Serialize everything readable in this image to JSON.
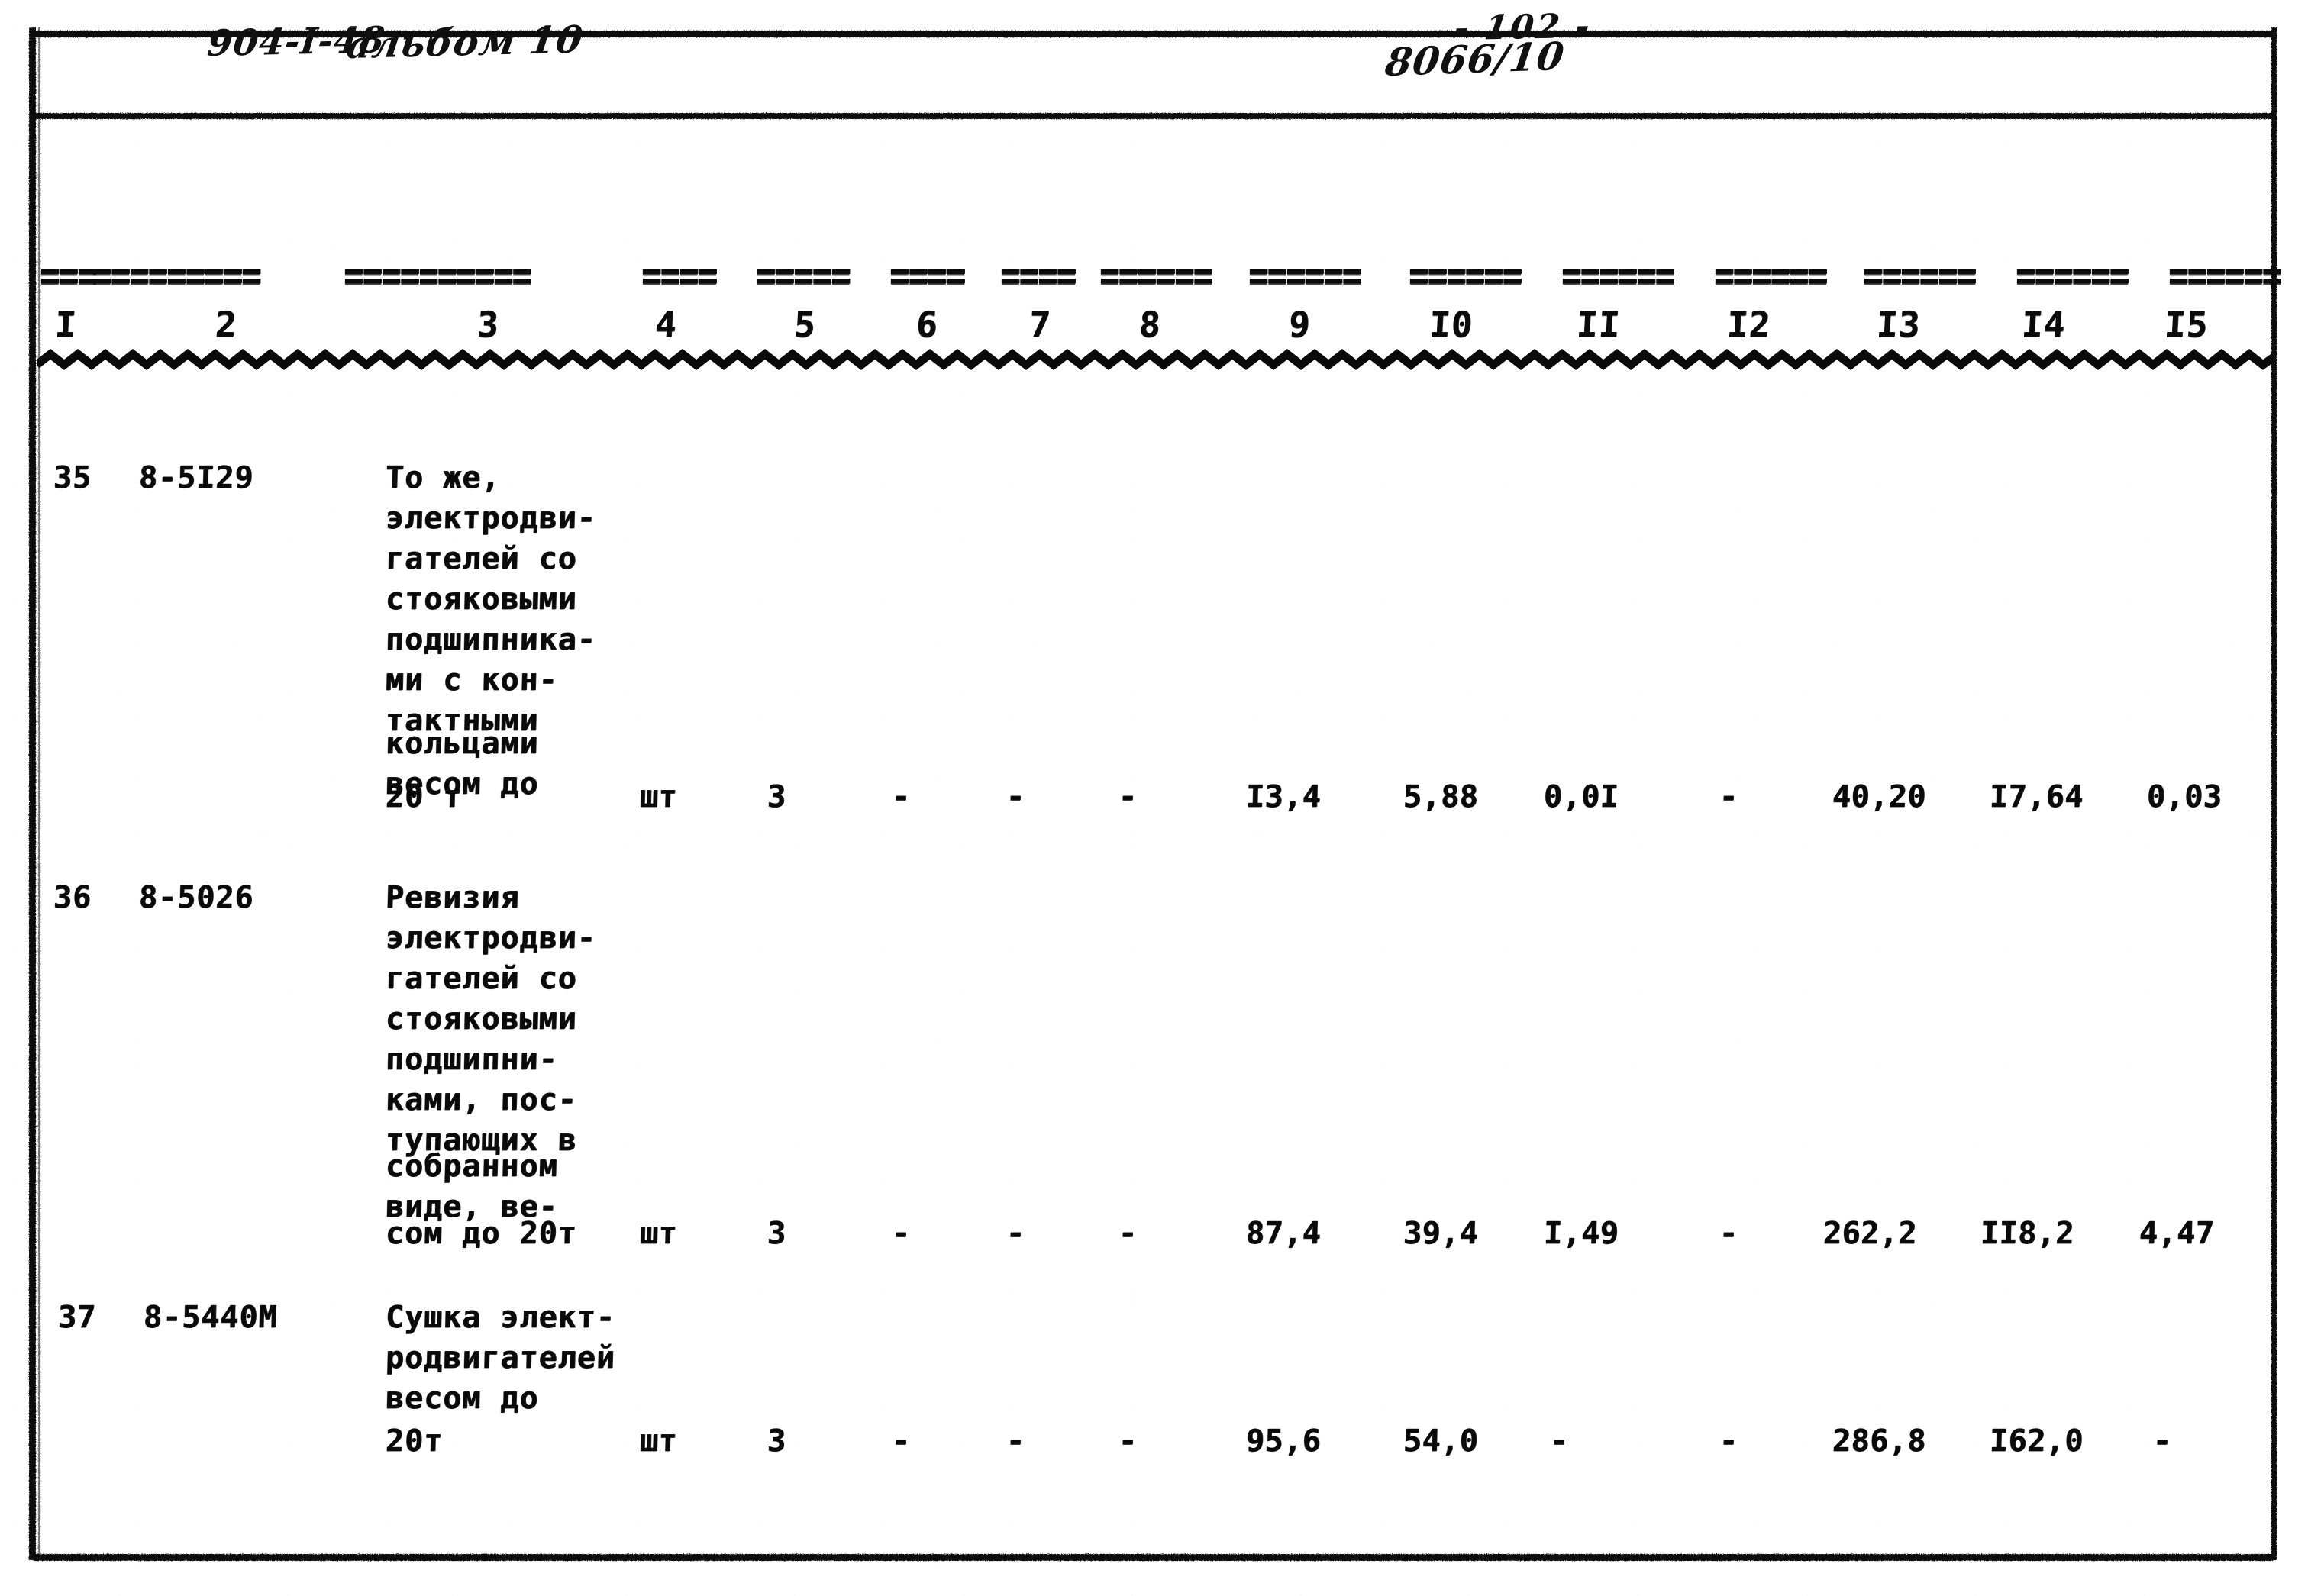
{
  "header": {
    "project_code": "904-I-48",
    "album": "альбом 10",
    "page_number": "- 102 -",
    "stamp": "8066/10"
  },
  "table": {
    "column_numbers": [
      "I",
      "2",
      "3",
      "4",
      "5",
      "6",
      "7",
      "8",
      "9",
      "I0",
      "II",
      "I2",
      "I3",
      "I4",
      "I5"
    ],
    "separator": {
      "segments": [
        "===",
        "=========",
        "==========",
        "====",
        "=====",
        "====",
        "====",
        "======",
        "======",
        "======",
        "======",
        "======",
        "======",
        "======",
        "======"
      ]
    },
    "rows": [
      {
        "num": "35",
        "code": "8-5I29",
        "description": [
          "То же,",
          "электродви-",
          "гателей со",
          "стояковыми",
          "подшипника-",
          "ми с кон-",
          "тактными",
          "кольцами",
          "весом до",
          "20 т"
        ],
        "unit": "шт",
        "qty": "3",
        "c6": "-",
        "c7": "-",
        "c8": "-",
        "c9": "I3,4",
        "c10": "5,88",
        "c11": "0,0I",
        "c12": "-",
        "c13": "40,20",
        "c14": "I7,64",
        "c15": "0,03"
      },
      {
        "num": "36",
        "code": "8-5026",
        "description": [
          "Ревизия",
          "электродви-",
          "гателей со",
          "стояковыми",
          "подшипни-",
          "ками, пос-",
          "тупающих в",
          "собранном",
          "виде, ве-",
          "сом до 20т"
        ],
        "unit": "шт",
        "qty": "3",
        "c6": "-",
        "c7": "-",
        "c8": "-",
        "c9": "87,4",
        "c10": "39,4",
        "c11": "I,49",
        "c12": "-",
        "c13": "262,2",
        "c14": "II8,2",
        "c15": "4,47"
      },
      {
        "num": "37",
        "code": "8-5440М",
        "description": [
          "Сушка элект-",
          "родвигателей",
          "весом до",
          "20т"
        ],
        "unit": "шт",
        "qty": "3",
        "c6": "-",
        "c7": "-",
        "c8": "-",
        "c9": "95,6",
        "c10": "54,0",
        "c11": "-",
        "c12": "-",
        "c13": "286,8",
        "c14": "I62,0",
        "c15": "-"
      }
    ]
  },
  "style": {
    "ink": "#0a0a0a",
    "paper": "#ffffff"
  }
}
